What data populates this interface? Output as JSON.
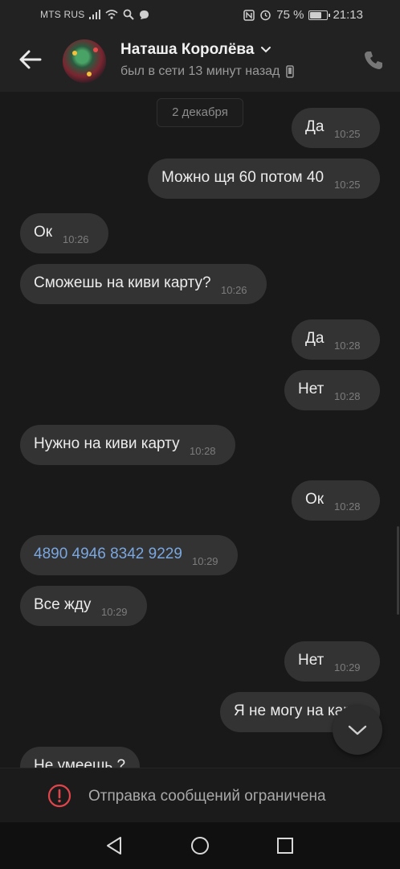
{
  "status_bar": {
    "carrier": "MTS RUS",
    "battery": "75 %",
    "battery_level": 0.75,
    "time": "21:13",
    "icons": [
      "signal-icon",
      "wifi-icon",
      "search-icon",
      "chat-icon",
      "nfc-icon",
      "alarm-icon",
      "battery-icon"
    ]
  },
  "header": {
    "contact_name": "Наташа Королёва",
    "status": "был в сети 13 минут назад",
    "colors": {
      "background": "#222222",
      "name": "#f1f1f1",
      "status": "#9a9a9a"
    }
  },
  "chat": {
    "date_separator": "2 декабря",
    "messages": [
      {
        "side": "out",
        "text": "Да",
        "time": "10:25"
      },
      {
        "side": "out",
        "text": "Можно щя 60 потом 40",
        "time": "10:25"
      },
      {
        "side": "in",
        "text": "Ок",
        "time": "10:26"
      },
      {
        "side": "in",
        "text": "Сможешь на киви карту?",
        "time": "10:26"
      },
      {
        "side": "out",
        "text": "Да",
        "time": "10:28"
      },
      {
        "side": "out",
        "text": "Нет",
        "time": "10:28"
      },
      {
        "side": "in",
        "text": "Нужно на киви карту",
        "time": "10:28"
      },
      {
        "side": "out",
        "text": "Ок",
        "time": "10:28"
      },
      {
        "side": "in",
        "text": "4890 4946 8342 9229",
        "time": "10:29",
        "link": true
      },
      {
        "side": "in",
        "text": "Все жду",
        "time": "10:29"
      },
      {
        "side": "out",
        "text": "Нет",
        "time": "10:29"
      },
      {
        "side": "out",
        "text": "Я не могу на карту",
        "time": ""
      },
      {
        "side": "in",
        "text": "Не умеешь ?",
        "time": ""
      }
    ],
    "colors": {
      "bubble": "#333333",
      "link": "#7aa7e0",
      "time": "#7c7c7c"
    }
  },
  "restricted_banner": {
    "text": "Отправка сообщений ограничена",
    "icon": "warning-icon",
    "accent": "#e0454b"
  },
  "nav_bar": {
    "buttons": [
      "back-triangle-icon",
      "home-circle-icon",
      "recents-square-icon"
    ]
  }
}
